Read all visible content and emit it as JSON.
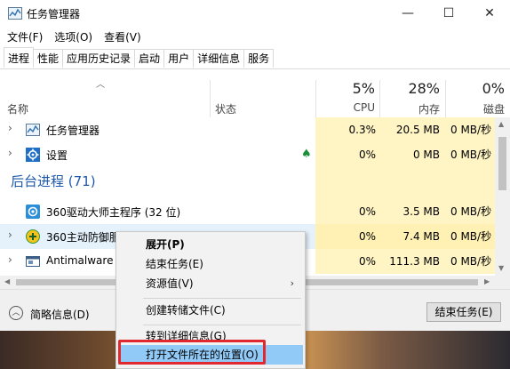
{
  "window": {
    "title": "任务管理器",
    "min": "—",
    "max": "☐",
    "close": "✕"
  },
  "menu": [
    "文件(F)",
    "选项(O)",
    "查看(V)"
  ],
  "tabs": [
    "进程",
    "性能",
    "应用历史记录",
    "启动",
    "用户",
    "详细信息",
    "服务"
  ],
  "active_tab": "进程",
  "columns": {
    "name": "名称",
    "status": "状态",
    "cpu_pct": "5%",
    "cpu_label": "CPU",
    "mem_pct": "28%",
    "mem_label": "内存",
    "disk_pct": "0%",
    "disk_label": "磁盘"
  },
  "rows": [
    {
      "name": "任务管理器",
      "cpu": "0.3%",
      "mem": "20.5 MB",
      "disk": "0 MB/秒",
      "icon": "task-manager-icon"
    },
    {
      "name": "设置",
      "cpu": "0%",
      "mem": "0 MB",
      "disk": "0 MB/秒",
      "icon": "settings-gear-icon",
      "status_icon": "leaf-icon"
    },
    {
      "group": "后台进程 (71)"
    },
    {
      "name": "360驱动大师主程序 (32 位)",
      "cpu": "0%",
      "mem": "3.5 MB",
      "disk": "0 MB/秒",
      "icon": "driver-master-icon"
    },
    {
      "name": "360主动防御服",
      "cpu": "0%",
      "mem": "7.4 MB",
      "disk": "0 MB/秒",
      "icon": "360-defense-icon"
    },
    {
      "name": "Antimalware",
      "cpu": "0%",
      "mem": "111.3 MB",
      "disk": "0 MB/秒",
      "icon": "antimalware-icon"
    }
  ],
  "footer": {
    "fewer_details": "简略信息(D)",
    "end_task": "结束任务(E)"
  },
  "context_menu": [
    {
      "label": "展开(P)",
      "bold": true
    },
    {
      "label": "结束任务(E)"
    },
    {
      "label": "资源值(V)",
      "submenu": true
    },
    {
      "label": "创建转储文件(C)"
    },
    {
      "label": "转到详细信息(G)"
    },
    {
      "label": "打开文件所在的位置(O)",
      "highlight": true
    }
  ],
  "colors": {
    "accent_blue": "#1e58a8",
    "highlight_cell": "#fff4c4",
    "menu_highlight": "#91c9f7",
    "annotation_red": "#e0282e"
  }
}
